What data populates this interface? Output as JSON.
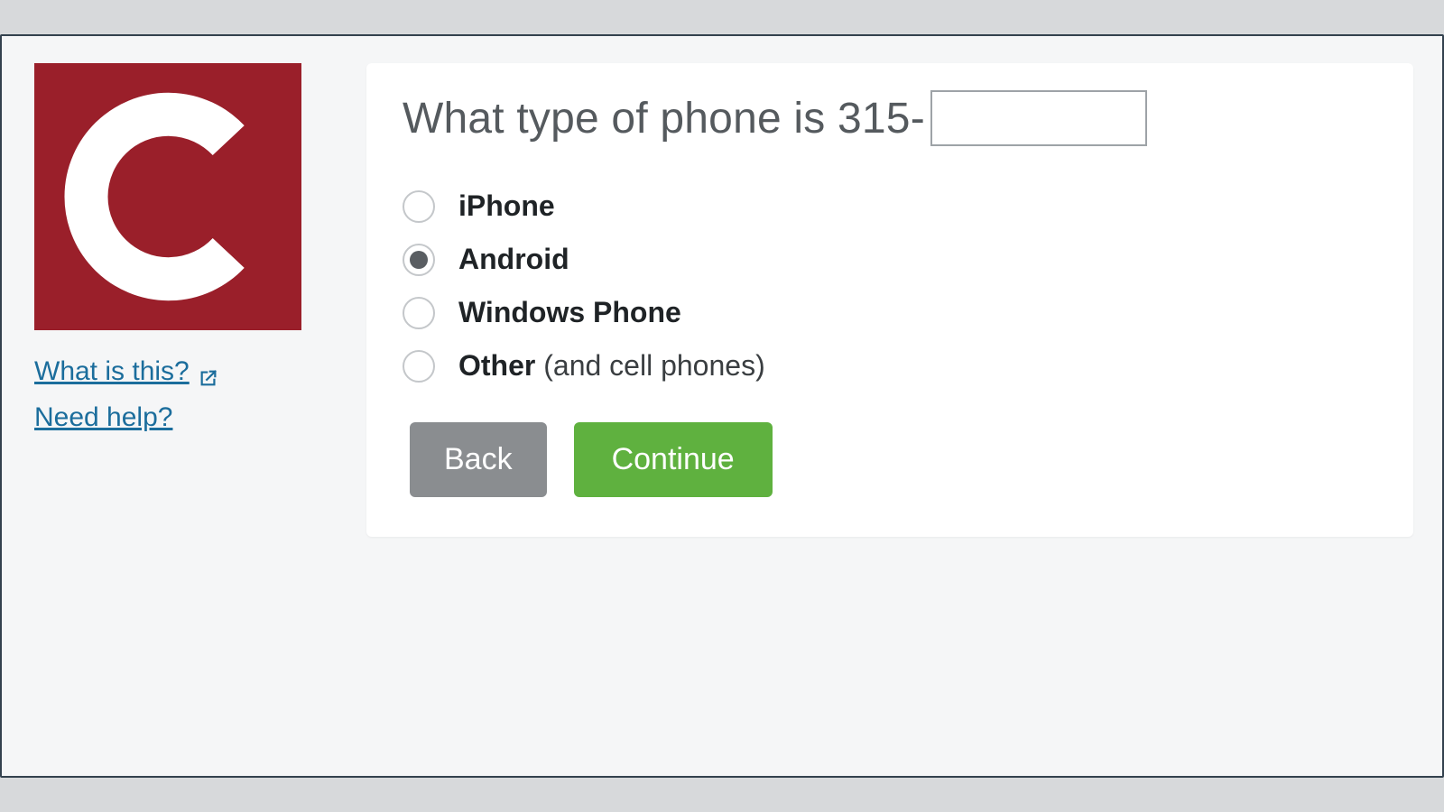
{
  "sidebar": {
    "logo_letter": "C",
    "links": {
      "what_is_this": "What is this?",
      "need_help": "Need help?"
    }
  },
  "main": {
    "heading_prefix": "What type of phone is 315-",
    "phone_suffix_value": "",
    "options": [
      {
        "label": "iPhone",
        "sub": "",
        "selected": false
      },
      {
        "label": "Android",
        "sub": "",
        "selected": true
      },
      {
        "label": "Windows Phone",
        "sub": "",
        "selected": false
      },
      {
        "label": "Other",
        "sub": " (and cell phones)",
        "selected": false
      }
    ],
    "buttons": {
      "back": "Back",
      "continue": "Continue"
    }
  }
}
